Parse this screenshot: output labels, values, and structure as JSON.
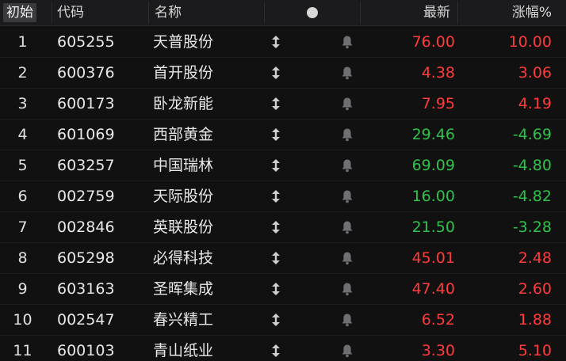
{
  "colors": {
    "up": "#ff3b3b",
    "down": "#2fc24a",
    "background": "#111112",
    "header_bg": "#1b1b1d"
  },
  "header": {
    "seq_label": "初始",
    "code_label": "代码",
    "name_label": "名称",
    "status_icon": "circle-icon",
    "price_label": "最新",
    "change_label": "涨幅%"
  },
  "rows": [
    {
      "seq": "1",
      "code": "605255",
      "name": "天普股份",
      "price": "76.00",
      "change": "10.00",
      "trend": "up"
    },
    {
      "seq": "2",
      "code": "600376",
      "name": "首开股份",
      "price": "4.38",
      "change": "3.06",
      "trend": "up"
    },
    {
      "seq": "3",
      "code": "600173",
      "name": "卧龙新能",
      "price": "7.95",
      "change": "4.19",
      "trend": "up"
    },
    {
      "seq": "4",
      "code": "601069",
      "name": "西部黄金",
      "price": "29.46",
      "change": "-4.69",
      "trend": "down"
    },
    {
      "seq": "5",
      "code": "603257",
      "name": "中国瑞林",
      "price": "69.09",
      "change": "-4.80",
      "trend": "down"
    },
    {
      "seq": "6",
      "code": "002759",
      "name": "天际股份",
      "price": "16.00",
      "change": "-4.82",
      "trend": "down"
    },
    {
      "seq": "7",
      "code": "002846",
      "name": "英联股份",
      "price": "21.50",
      "change": "-3.28",
      "trend": "down"
    },
    {
      "seq": "8",
      "code": "605298",
      "name": "必得科技",
      "price": "45.01",
      "change": "2.48",
      "trend": "up"
    },
    {
      "seq": "9",
      "code": "603163",
      "name": "圣晖集成",
      "price": "47.40",
      "change": "2.60",
      "trend": "up"
    },
    {
      "seq": "10",
      "code": "002547",
      "name": "春兴精工",
      "price": "6.52",
      "change": "1.88",
      "trend": "up"
    },
    {
      "seq": "11",
      "code": "600103",
      "name": "青山纸业",
      "price": "3.30",
      "change": "5.10",
      "trend": "up"
    }
  ],
  "icons": {
    "move": "drag-handle-icon",
    "alert": "bell-icon"
  }
}
